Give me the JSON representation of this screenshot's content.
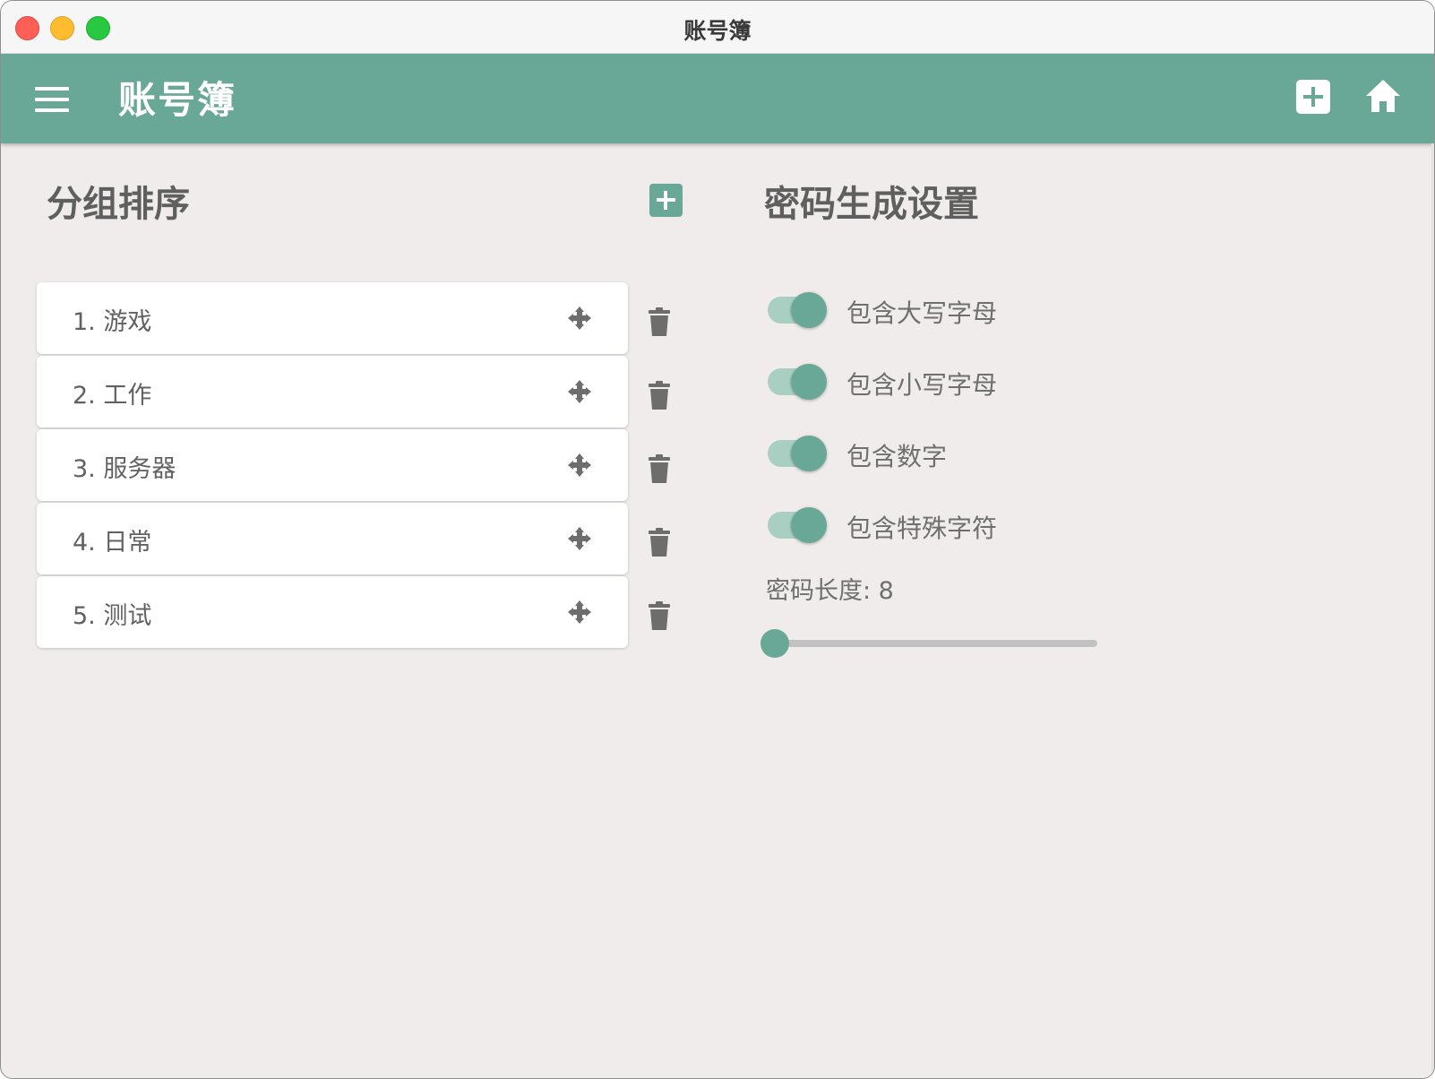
{
  "window": {
    "title": "账号簿",
    "controls": [
      "close",
      "minimize",
      "zoom"
    ]
  },
  "appbar": {
    "title": "账号簿",
    "menu_icon": "hamburger-menu-icon",
    "actions": [
      {
        "name": "add",
        "icon": "plus-square-icon"
      },
      {
        "name": "home",
        "icon": "home-icon"
      }
    ]
  },
  "groups": {
    "title": "分组排序",
    "add_icon": "plus-square-icon",
    "items": [
      {
        "label": "1. 游戏"
      },
      {
        "label": "2. 工作"
      },
      {
        "label": "3. 服务器"
      },
      {
        "label": "4. 日常"
      },
      {
        "label": "5. 测试"
      }
    ],
    "item_icons": {
      "drag": "move-arrows-icon",
      "delete": "trash-icon"
    }
  },
  "password_settings": {
    "title": "密码生成设置",
    "options": [
      {
        "label": "包含大写字母",
        "enabled": true
      },
      {
        "label": "包含小写字母",
        "enabled": true
      },
      {
        "label": "包含数字",
        "enabled": true
      },
      {
        "label": "包含特殊字符",
        "enabled": true
      }
    ],
    "length_label": "密码长度: 8",
    "length_value": 8,
    "length_slider_fraction": 0.0
  },
  "colors": {
    "primary": "#69a896",
    "toggle_track": "#a9cfc2",
    "background": "#efeceb",
    "text": "#616161"
  }
}
